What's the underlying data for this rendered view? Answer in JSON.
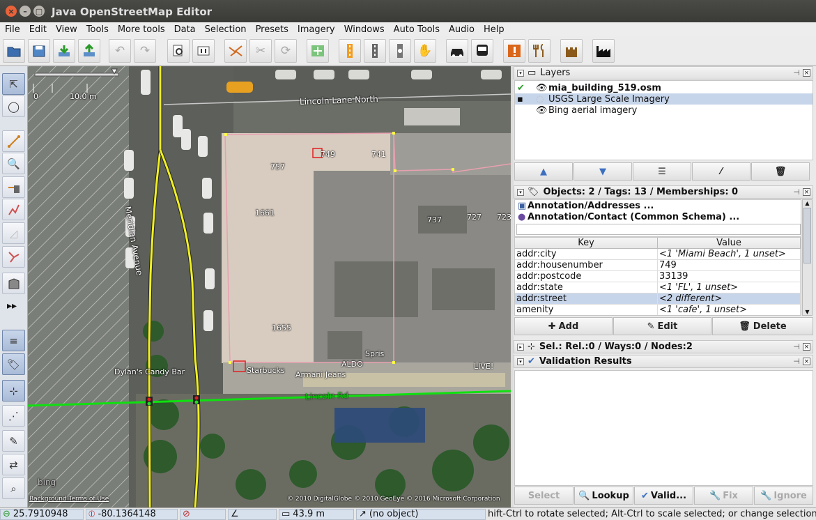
{
  "window": {
    "title": "Java OpenStreetMap Editor"
  },
  "menu": [
    "File",
    "Edit",
    "View",
    "Tools",
    "More tools",
    "Data",
    "Selection",
    "Presets",
    "Imagery",
    "Windows",
    "Auto Tools",
    "Audio",
    "Help"
  ],
  "map": {
    "scale_zero": "0",
    "scale_label": "10.0 m",
    "streets": {
      "lincoln_lane": "Lincoln Lane North",
      "lincoln_rd": "Lincoln Rd",
      "meridian": "Meridian Avenue"
    },
    "housenumbers": [
      "749",
      "741",
      "757",
      "1661",
      "737",
      "727",
      "723",
      "1655"
    ],
    "pois": {
      "dylans": "Dylan's Candy Bar",
      "starbucks": "Starbucks",
      "armani": "Armani Jeans",
      "aldo": "ALDO",
      "spris": "Spris",
      "live": "LIVE!"
    },
    "attribution": "© 2010 DigitalGlobe © 2010 GeoEye © 2016 Microsoft Corporation",
    "background_terms": "Background Terms of Use",
    "bing_logo": "bing"
  },
  "layers": {
    "title": "Layers",
    "items": [
      {
        "name": "mia_building_519.osm",
        "bold": true
      },
      {
        "name": "USGS Large Scale Imagery",
        "bold": false
      },
      {
        "name": "Bing aerial imagery",
        "bold": false
      }
    ]
  },
  "objects": {
    "title": "Objects: 2 / Tags: 13 / Memberships: 0",
    "presets": [
      "Annotation/Addresses ...",
      "Annotation/Contact (Common Schema) ..."
    ],
    "key_header": "Key",
    "value_header": "Value",
    "tags": [
      {
        "key": "addr:city",
        "value": "<1 'Miami Beach', 1 unset>",
        "italic": true
      },
      {
        "key": "addr:housenumber",
        "value": "749",
        "italic": false
      },
      {
        "key": "addr:postcode",
        "value": "33139",
        "italic": false
      },
      {
        "key": "addr:state",
        "value": "<1 'FL', 1 unset>",
        "italic": true
      },
      {
        "key": "addr:street",
        "value": "<2 different>",
        "italic": true
      },
      {
        "key": "amenity",
        "value": "<1 'cafe', 1 unset>",
        "italic": true
      }
    ],
    "add": "Add",
    "edit": "Edit",
    "delete": "Delete"
  },
  "selection": {
    "title": "Sel.: Rel.:0 / Ways:0 / Nodes:2"
  },
  "validation": {
    "title": "Validation Results",
    "buttons": [
      "Select",
      "Lookup",
      "Valid...",
      "Fix",
      "Ignore"
    ]
  },
  "status": {
    "lat": "25.7910948",
    "lon": "-80.1364148",
    "distance": "43.9 m",
    "object": "(no object)",
    "help": "hift-Ctrl to rotate selected; Alt-Ctrl to scale selected; or change selection"
  }
}
